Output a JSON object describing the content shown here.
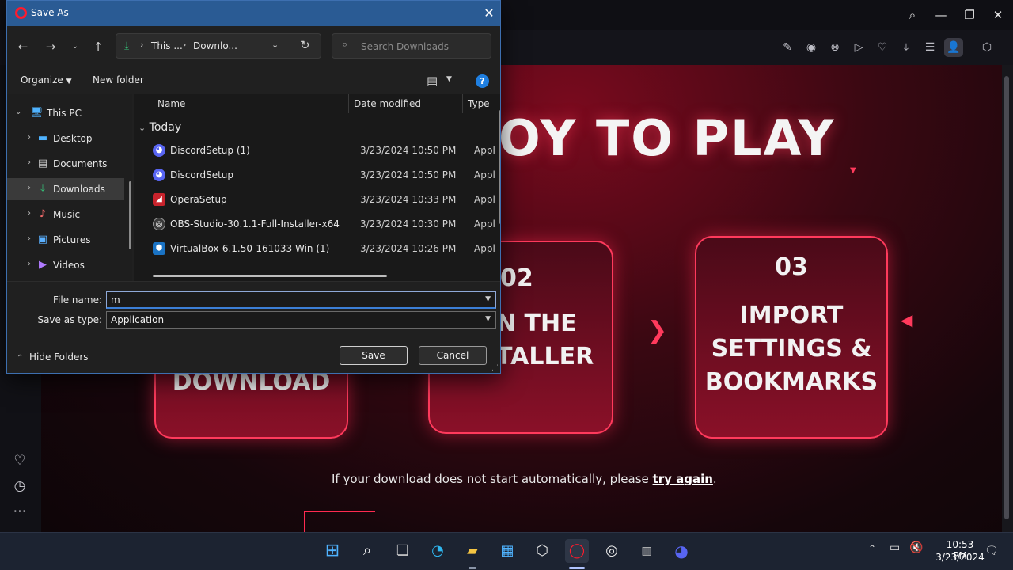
{
  "browser": {
    "hero_title": "OY TO PLAY",
    "cards": [
      {
        "number": "",
        "text": "DOWNLOAD"
      },
      {
        "number": "02",
        "text_line1": "N THE",
        "text_line2": "TALLER"
      },
      {
        "number": "03",
        "text_line1": "IMPORT",
        "text_line2": "SETTINGS &",
        "text_line3": "BOOKMARKS"
      }
    ],
    "retry_prefix": "If your download does not start automatically, please ",
    "retry_link": "try again",
    "retry_suffix": "."
  },
  "dialog": {
    "title": "Save As",
    "address": {
      "part1": "This ...",
      "part2": "Downlo..."
    },
    "search_placeholder": "Search Downloads",
    "organize_label": "Organize",
    "new_folder_label": "New folder",
    "help_label": "?",
    "tree": [
      {
        "label": "This PC",
        "icon": "monitor-icon"
      },
      {
        "label": "Desktop",
        "icon": "desktop-icon"
      },
      {
        "label": "Documents",
        "icon": "documents-icon"
      },
      {
        "label": "Downloads",
        "icon": "downloads-icon",
        "selected": true
      },
      {
        "label": "Music",
        "icon": "music-icon"
      },
      {
        "label": "Pictures",
        "icon": "pictures-icon"
      },
      {
        "label": "Videos",
        "icon": "videos-icon"
      }
    ],
    "columns": {
      "name": "Name",
      "date": "Date modified",
      "type": "Type"
    },
    "group_label": "Today",
    "files": [
      {
        "name": "DiscordSetup (1)",
        "date": "3/23/2024 10:50 PM",
        "type": "Appl",
        "icon": "discord-icon"
      },
      {
        "name": "DiscordSetup",
        "date": "3/23/2024 10:50 PM",
        "type": "Appl",
        "icon": "discord-icon"
      },
      {
        "name": "OperaSetup",
        "date": "3/23/2024 10:33 PM",
        "type": "Appl",
        "icon": "opera-setup-icon"
      },
      {
        "name": "OBS-Studio-30.1.1-Full-Installer-x64",
        "date": "3/23/2024 10:30 PM",
        "type": "Appl",
        "icon": "obs-icon"
      },
      {
        "name": "VirtualBox-6.1.50-161033-Win (1)",
        "date": "3/23/2024 10:26 PM",
        "type": "Appl",
        "icon": "virtualbox-icon"
      }
    ],
    "file_name_label": "File name:",
    "file_name_value": "m",
    "save_type_label": "Save as type:",
    "save_type_value": "Application",
    "hide_folders_label": "Hide Folders",
    "save_label": "Save",
    "cancel_label": "Cancel"
  },
  "taskbar": {
    "time": "10:53 PM",
    "date": "3/23/2024"
  },
  "colors": {
    "accent_red": "#ff3a5c",
    "dialog_title_bar": "#2a5b94",
    "taskbar": "#1c2331"
  }
}
